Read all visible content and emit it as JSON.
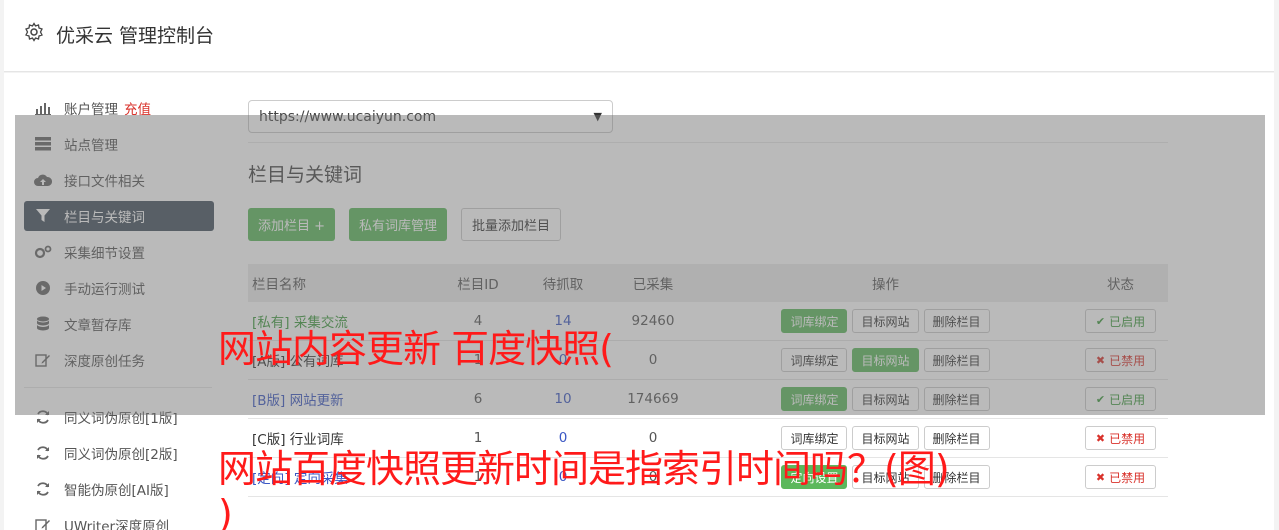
{
  "header": {
    "title": "优采云 管理控制台"
  },
  "sidebar": {
    "items": [
      {
        "label": "账户管理",
        "icon": "bar-chart-icon",
        "badge": "充值"
      },
      {
        "label": "站点管理",
        "icon": "server-icon"
      },
      {
        "label": "接口文件相关",
        "icon": "cloud-upload-icon"
      },
      {
        "label": "栏目与关键词",
        "icon": "filter-icon",
        "active": true
      },
      {
        "label": "采集细节设置",
        "icon": "gears-icon"
      },
      {
        "label": "手动运行测试",
        "icon": "play-circle-icon"
      },
      {
        "label": "文章暂存库",
        "icon": "database-icon"
      },
      {
        "label": "深度原创任务",
        "icon": "edit-icon"
      }
    ],
    "items2": [
      {
        "label": "同义词伪原创[1版]",
        "icon": "refresh-icon"
      },
      {
        "label": "同义词伪原创[2版]",
        "icon": "refresh-icon"
      },
      {
        "label": "智能伪原创[AI版]",
        "icon": "refresh-icon"
      },
      {
        "label": "UWriter深度原创",
        "icon": "edit-icon"
      }
    ]
  },
  "content": {
    "site_select": "https://www.ucaiyun.com",
    "section_title": "栏目与关键词",
    "buttons": {
      "add": "添加栏目 +",
      "private": "私有词库管理",
      "batch": "批量添加栏目"
    },
    "table": {
      "headers": {
        "name": "栏目名称",
        "id": "栏目ID",
        "pending": "待抓取",
        "done": "已采集",
        "ops": "操作",
        "status": "状态"
      },
      "rows": [
        {
          "name": "[私有] 采集交流",
          "id": "4",
          "pending": "14",
          "done": "92460",
          "op1": "词库绑定",
          "op2": "目标网站",
          "op3": "删除栏目",
          "status": "已启用"
        },
        {
          "name": "[A版] 公有词库",
          "id": "1",
          "pending": "0",
          "done": "0",
          "op1": "词库绑定",
          "op2": "目标网站",
          "op3": "删除栏目",
          "status": "已禁用"
        },
        {
          "name": "[B版] 网站更新",
          "id": "6",
          "pending": "10",
          "done": "174669",
          "op1": "词库绑定",
          "op2": "目标网站",
          "op3": "删除栏目",
          "status": "已启用"
        },
        {
          "name": "[C版] 行业词库",
          "id": "1",
          "pending": "0",
          "done": "0",
          "op1": "词库绑定",
          "op2": "目标网站",
          "op3": "删除栏目",
          "status": "已禁用"
        },
        {
          "name": "[定向] 定向采集",
          "id": "1",
          "pending": "0",
          "done": "0",
          "op1": "定向设置",
          "op2": "目标网站",
          "op3": "删除栏目",
          "status": "已禁用"
        }
      ]
    }
  },
  "overlay_text": {
    "line1": "网站内容更新 百度快照(",
    "line2": "网站百度快照更新时间是指索引时间吗？(图)",
    "line3": ")"
  },
  "colors": {
    "green": "#5cb85c",
    "red": "#d9322b",
    "link": "#3a57c4",
    "sidebar_active": "#44525e",
    "overlay_text": "#ff1a1a"
  }
}
